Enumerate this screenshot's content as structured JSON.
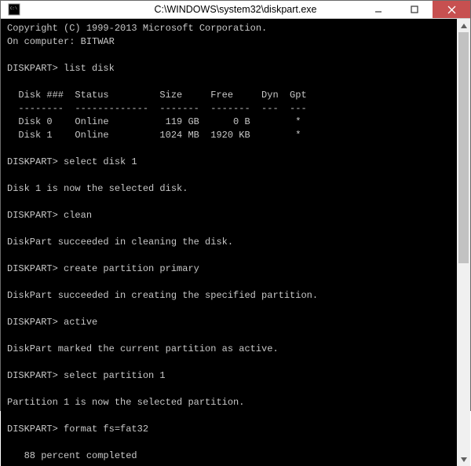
{
  "window": {
    "title": "C:\\WINDOWS\\system32\\diskpart.exe"
  },
  "terminal": {
    "copyright": "Copyright (C) 1999-2013 Microsoft Corporation.",
    "computer_line": "On computer: BITWAR",
    "prompt": "DISKPART>",
    "cmd_list_disk": "list disk",
    "table": {
      "header": "  Disk ###  Status         Size     Free     Dyn  Gpt",
      "divider": "  --------  -------------  -------  -------  ---  ---",
      "rows": [
        "  Disk 0    Online          119 GB      0 B        *",
        "  Disk 1    Online         1024 MB  1920 KB        *"
      ]
    },
    "cmd_select_disk": "select disk 1",
    "msg_select_disk": "Disk 1 is now the selected disk.",
    "cmd_clean": "clean",
    "msg_clean": "DiskPart succeeded in cleaning the disk.",
    "cmd_create_partition": "create partition primary",
    "msg_create_partition": "DiskPart succeeded in creating the specified partition.",
    "cmd_active": "active",
    "msg_active": "DiskPart marked the current partition as active.",
    "cmd_select_partition": "select partition 1",
    "msg_select_partition": "Partition 1 is now the selected partition.",
    "cmd_format": "format fs=fat32",
    "progress": "   88 percent completed"
  }
}
